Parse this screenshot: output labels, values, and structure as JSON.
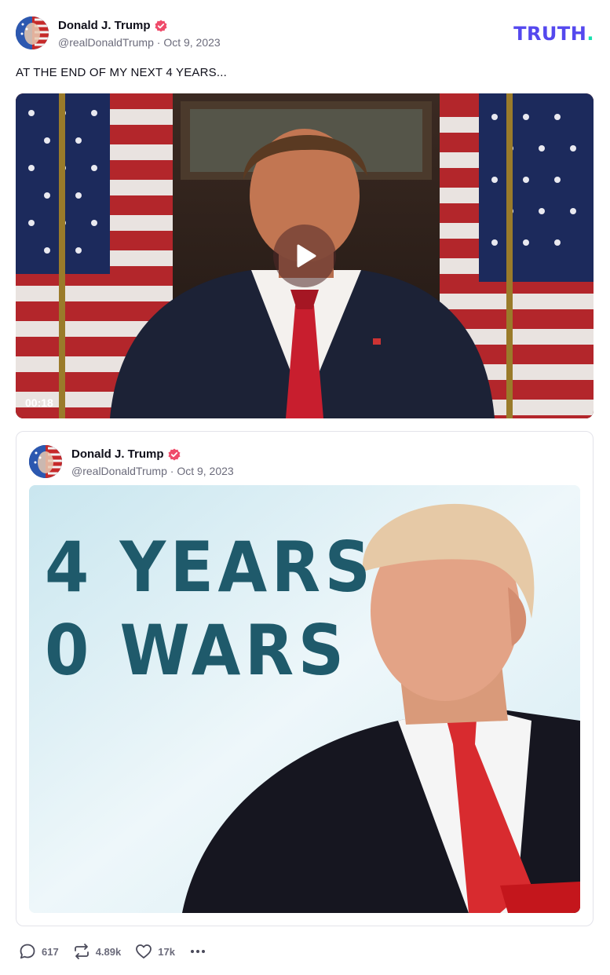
{
  "post": {
    "author_name": "Donald J. Trump",
    "handle": "@realDonaldTrump",
    "date": "Oct 9, 2023",
    "text": "AT THE END OF MY NEXT 4 YEARS..."
  },
  "brand": {
    "logo": "TRUTH",
    "logo_dot": ".",
    "accent": "#5448ee",
    "dot_color": "#17e0b0"
  },
  "video": {
    "duration": "00:18"
  },
  "quoted": {
    "author_name": "Donald J. Trump",
    "handle": "@realDonaldTrump",
    "date": "Oct 9, 2023",
    "image_text_line1": "4 YEARS",
    "image_text_line2": "0 WARS"
  },
  "actions": {
    "replies": "617",
    "retruths": "4.89k",
    "likes": "17k"
  },
  "icons": [
    "verified-badge-icon",
    "play-icon",
    "reply-icon",
    "retruth-icon",
    "like-icon",
    "more-icon"
  ]
}
